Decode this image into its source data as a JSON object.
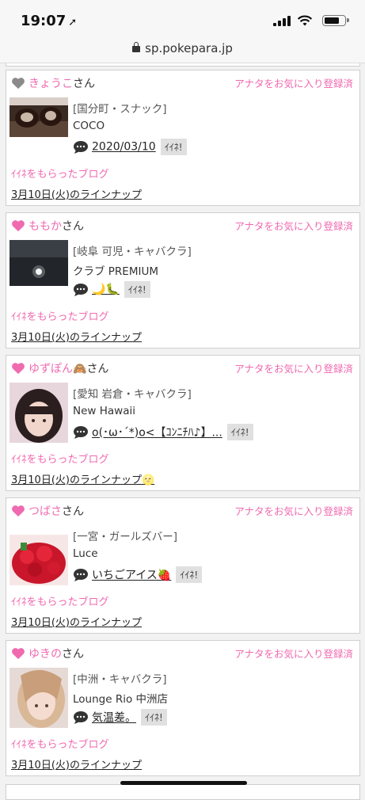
{
  "status": {
    "time": "19:07",
    "location_glyph": "➚"
  },
  "browser": {
    "url": "sp.pokepara.jp"
  },
  "colors": {
    "accent_pink": "#f06ab0",
    "inactive_heart": "#888888"
  },
  "cards": [
    {
      "name": "きょうこ",
      "san": "さん",
      "heart": "gray",
      "fav_status": "アナタをお気に入り登録済",
      "area": "[国分町・スナック]",
      "shop": "COCO",
      "blog_title": "2020/03/10",
      "iine": "ｲｲﾈ!",
      "liked": "ｲｲﾈをもらったブログ",
      "lineup": "3月10日(火)のラインナップ",
      "thumb": "chocolate"
    },
    {
      "name": "ももか",
      "san": "さん",
      "heart": "pink",
      "fav_status": "アナタをお気に入り登録済",
      "area": "[岐阜 可児・キャバクラ]",
      "shop": "クラブ PREMIUM",
      "blog_title": "🌙🐛",
      "iine": "ｲｲﾈ!",
      "liked": "ｲｲﾈをもらったブログ",
      "lineup": "3月10日(火)のラインナップ",
      "thumb": "moon"
    },
    {
      "name": "ゆずぽん🙈",
      "san": "さん",
      "heart": "pink",
      "fav_status": "アナタをお気に入り登録済",
      "area": "[愛知 岩倉・キャバクラ]",
      "shop": "New Hawaii",
      "blog_title": "o(･ω･´*)o<【ｺﾝﾆﾁﾊ♪】...",
      "iine": "ｲｲﾈ!",
      "liked": "ｲｲﾈをもらったブログ",
      "lineup": "3月10日(火)のラインナップ",
      "lineup_badge": "🌝",
      "thumb": "girl"
    },
    {
      "name": "つばさ",
      "san": "さん",
      "heart": "pink",
      "fav_status": "アナタをお気に入り登録済",
      "area": "[一宮・ガールズバー]",
      "shop": "Luce",
      "blog_title": "いちごアイス🍓",
      "iine": "ｲｲﾈ!",
      "liked": "ｲｲﾈをもらったブログ",
      "lineup": "3月10日(火)のラインナップ",
      "thumb": "strawberry"
    },
    {
      "name": "ゆきの",
      "san": "さん",
      "heart": "pink",
      "fav_status": "アナタをお気に入り登録済",
      "area": "[中洲・キャバクラ]",
      "shop": "Lounge Rio 中洲店",
      "blog_title": "気温差。",
      "iine": "ｲｲﾈ!",
      "liked": "ｲｲﾈをもらったブログ",
      "lineup": "3月10日(火)のラインナップ",
      "thumb": "blonde"
    }
  ]
}
